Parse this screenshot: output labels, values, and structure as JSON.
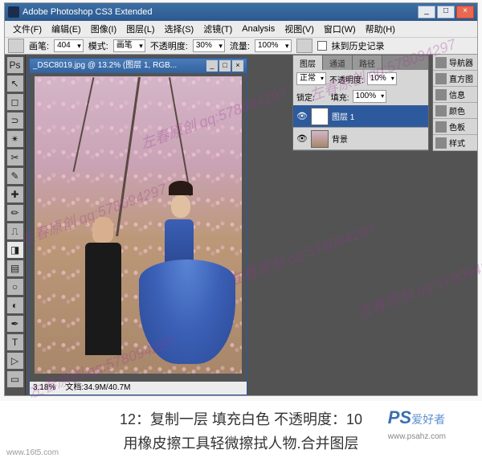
{
  "app": {
    "title": "Adobe Photoshop CS3 Extended"
  },
  "menu": {
    "file": "文件(F)",
    "edit": "编辑(E)",
    "image": "图像(I)",
    "layer": "图层(L)",
    "select": "选择(S)",
    "filter": "滤镜(T)",
    "analysis": "Analysis",
    "view": "视图(V)",
    "window": "窗口(W)",
    "help": "帮助(H)"
  },
  "options": {
    "brush_label": "画笔:",
    "brush_size": "404",
    "mode_label": "模式:",
    "mode_val": "画笔",
    "opacity_label": "不透明度:",
    "opacity_val": "30%",
    "flow_label": "流量:",
    "flow_val": "100%",
    "erase_hist": "抹到历史记录"
  },
  "doc": {
    "title": "_DSC8019.jpg @ 13.2% (图层 1, RGB...",
    "zoom": "3.18%",
    "size": "文档:34.9M/40.7M"
  },
  "layers_panel": {
    "tabs": {
      "layers": "图层",
      "channels": "通道",
      "paths": "路径"
    },
    "blend": "正常",
    "opacity_label": "不透明度:",
    "opacity": "10%",
    "lock_label": "锁定:",
    "fill_label": "填充:",
    "fill": "100%",
    "layer1": "图层 1",
    "bg": "背景"
  },
  "side": {
    "nav": "导航器",
    "histo": "直方图",
    "info": "信息",
    "color": "颜色",
    "swatch": "色板",
    "style": "样式"
  },
  "caption": {
    "l1": "12：复制一层  填充白色  不透明度：10",
    "l2": "用橡皮擦工具轻微擦拭人物.合并图层"
  },
  "wm": "左春原创 qq:578094297",
  "brand": {
    "ps": "PS",
    "name": "爱好者",
    "url": "www.psahz.com"
  },
  "site": "www.16t5.com"
}
